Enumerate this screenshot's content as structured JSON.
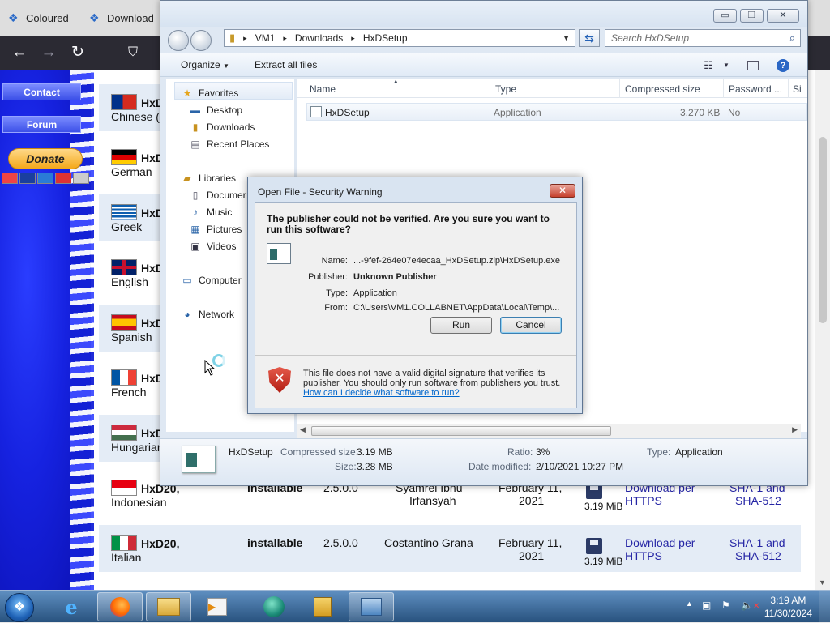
{
  "browser": {
    "tabs": [
      {
        "label": "Coloured"
      },
      {
        "label": "Download"
      }
    ],
    "sidebar": {
      "contact": "Contact",
      "forum": "Forum",
      "donate": "Donate"
    },
    "rows": [
      {
        "name": "HxD",
        "sub": "Chinese ("
      },
      {
        "name": "HxD",
        "sub": "German"
      },
      {
        "name": "HxD",
        "sub": "Greek"
      },
      {
        "name": "HxD",
        "sub": "English"
      },
      {
        "name": "HxD",
        "sub": "Spanish"
      },
      {
        "name": "HxD",
        "sub": "French"
      },
      {
        "name": "HxD",
        "sub": "Hungarian"
      },
      {
        "name": "HxD20,",
        "sub": "Indonesian",
        "type": "installable",
        "version": "2.5.0.0",
        "author1": "Syamrel Ibnu",
        "author2": "Irfansyah",
        "date1": "February 11,",
        "date2": "2021",
        "size": "3.19 MiB",
        "dl1": "Download per",
        "dl2": "HTTPS",
        "hash1": "SHA-1 and",
        "hash2": "SHA-512"
      },
      {
        "name": "HxD20,",
        "sub": "Italian",
        "type": "installable",
        "version": "2.5.0.0",
        "author1": "Costantino Grana",
        "author2": "",
        "date1": "February 11,",
        "date2": "2021",
        "size": "3.19 MiB",
        "dl1": "Download per",
        "dl2": "HTTPS",
        "hash1": "SHA-1 and",
        "hash2": "SHA-512"
      }
    ]
  },
  "explorer": {
    "breadcrumb": [
      "VM1",
      "Downloads",
      "HxDSetup"
    ],
    "search_placeholder": "Search HxDSetup",
    "toolbar": {
      "organize": "Organize",
      "extract": "Extract all files"
    },
    "nav": {
      "favorites": "Favorites",
      "desktop": "Desktop",
      "downloads": "Downloads",
      "recent": "Recent Places",
      "libraries": "Libraries",
      "documents": "Documer",
      "music": "Music",
      "pictures": "Pictures",
      "videos": "Videos",
      "computer": "Computer",
      "network": "Network"
    },
    "columns": {
      "name": "Name",
      "type": "Type",
      "compressed": "Compressed size",
      "password": "Password ...",
      "size": "Si"
    },
    "file": {
      "name": "HxDSetup",
      "type": "Application",
      "compressed": "3,270 KB",
      "password": "No"
    },
    "details": {
      "name": "HxDSetup",
      "compressed_label": "Compressed size:",
      "compressed_value": "3.19 MB",
      "size_label": "Size:",
      "size_value": "3.28 MB",
      "ratio_label": "Ratio:",
      "ratio_value": "3%",
      "modified_label": "Date modified:",
      "modified_value": "2/10/2021 10:27 PM",
      "type_label": "Type:",
      "type_value": "Application"
    }
  },
  "dialog": {
    "title": "Open File - Security Warning",
    "question": "The publisher could not be verified.  Are you sure you want to run this software?",
    "name_label": "Name:",
    "name_value": "...-9fef-264e07e4ecaa_HxDSetup.zip\\HxDSetup.exe",
    "publisher_label": "Publisher:",
    "publisher_value": "Unknown Publisher",
    "type_label": "Type:",
    "type_value": "Application",
    "from_label": "From:",
    "from_value": "C:\\Users\\VM1.COLLABNET\\AppData\\Local\\Temp\\...",
    "run": "Run",
    "cancel": "Cancel",
    "warning": "This file does not have a valid digital signature that verifies its publisher.  You should only run software from publishers you trust.",
    "help_link": "How can I decide what software to run?"
  },
  "taskbar": {
    "time": "3:19 AM",
    "date": "11/30/2024"
  }
}
